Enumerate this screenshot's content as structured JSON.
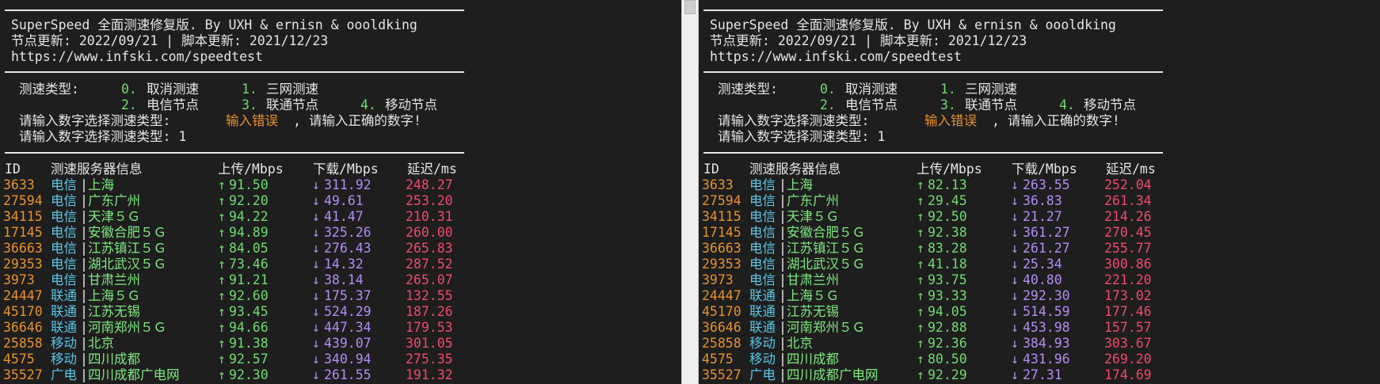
{
  "header": {
    "title": "SuperSpeed 全面测速修复版. By UXH & ernisn & oooldking",
    "update": "节点更新: 2022/09/21 | 脚本更新: 2021/12/23",
    "url": "https://www.infski.com/speedtest"
  },
  "menu": {
    "label": "测速类型:",
    "options": [
      {
        "num": "0.",
        "label": "取消测速"
      },
      {
        "num": "1.",
        "label": "三网测速"
      },
      {
        "num": "2.",
        "label": "电信节点"
      },
      {
        "num": "3.",
        "label": "联通节点"
      },
      {
        "num": "4.",
        "label": "移动节点"
      }
    ],
    "prompt1": "请输入数字选择测速类型:",
    "error": "输入错误",
    "error_suffix": ", 请输入正确的数字!",
    "prompt2": "请输入数字选择测速类型: 1"
  },
  "table": {
    "columns": [
      "ID",
      "测速服务器信息",
      "上传/Mbps",
      "下载/Mbps",
      "延迟/ms"
    ],
    "up_icon": "up-arrow-icon",
    "down_icon": "down-arrow-icon"
  },
  "left": {
    "rows": [
      {
        "id": "3633",
        "isp": "电信",
        "loc": "上海",
        "up": "91.50",
        "down": "311.92",
        "lat": "248.27"
      },
      {
        "id": "27594",
        "isp": "电信",
        "loc": "广东广州",
        "up": "92.20",
        "down": "49.61",
        "lat": "253.20"
      },
      {
        "id": "34115",
        "isp": "电信",
        "loc": "天津５Ｇ",
        "up": "94.22",
        "down": "41.47",
        "lat": "210.31"
      },
      {
        "id": "17145",
        "isp": "电信",
        "loc": "安徽合肥５Ｇ",
        "up": "94.89",
        "down": "325.26",
        "lat": "260.00"
      },
      {
        "id": "36663",
        "isp": "电信",
        "loc": "江苏镇江５Ｇ",
        "up": "84.05",
        "down": "276.43",
        "lat": "265.83"
      },
      {
        "id": "29353",
        "isp": "电信",
        "loc": "湖北武汉５Ｇ",
        "up": "73.46",
        "down": "14.32",
        "lat": "287.52"
      },
      {
        "id": "3973",
        "isp": "电信",
        "loc": "甘肃兰州",
        "up": "91.21",
        "down": "38.14",
        "lat": "265.07"
      },
      {
        "id": "24447",
        "isp": "联通",
        "loc": "上海５Ｇ",
        "up": "92.60",
        "down": "175.37",
        "lat": "132.55"
      },
      {
        "id": "45170",
        "isp": "联通",
        "loc": "江苏无锡",
        "up": "93.45",
        "down": "524.29",
        "lat": "187.26"
      },
      {
        "id": "36646",
        "isp": "联通",
        "loc": "河南郑州５Ｇ",
        "up": "94.66",
        "down": "447.34",
        "lat": "179.53"
      },
      {
        "id": "25858",
        "isp": "移动",
        "loc": "北京",
        "up": "91.38",
        "down": "439.07",
        "lat": "301.05"
      },
      {
        "id": "4575",
        "isp": "移动",
        "loc": "四川成都",
        "up": "92.57",
        "down": "340.94",
        "lat": "275.35"
      },
      {
        "id": "35527",
        "isp": "广电",
        "loc": "四川成都广电网",
        "up": "92.30",
        "down": "261.55",
        "lat": "191.32"
      }
    ]
  },
  "right": {
    "rows": [
      {
        "id": "3633",
        "isp": "电信",
        "loc": "上海",
        "up": "82.13",
        "down": "263.55",
        "lat": "252.04"
      },
      {
        "id": "27594",
        "isp": "电信",
        "loc": "广东广州",
        "up": "29.45",
        "down": "36.83",
        "lat": "261.34"
      },
      {
        "id": "34115",
        "isp": "电信",
        "loc": "天津５Ｇ",
        "up": "92.50",
        "down": "21.27",
        "lat": "214.26"
      },
      {
        "id": "17145",
        "isp": "电信",
        "loc": "安徽合肥５Ｇ",
        "up": "92.38",
        "down": "361.27",
        "lat": "270.45"
      },
      {
        "id": "36663",
        "isp": "电信",
        "loc": "江苏镇江５Ｇ",
        "up": "83.28",
        "down": "261.27",
        "lat": "255.77"
      },
      {
        "id": "29353",
        "isp": "电信",
        "loc": "湖北武汉５Ｇ",
        "up": "41.18",
        "down": "25.34",
        "lat": "300.86"
      },
      {
        "id": "3973",
        "isp": "电信",
        "loc": "甘肃兰州",
        "up": "93.75",
        "down": "40.80",
        "lat": "221.20"
      },
      {
        "id": "24447",
        "isp": "联通",
        "loc": "上海５Ｇ",
        "up": "93.33",
        "down": "292.30",
        "lat": "173.02"
      },
      {
        "id": "45170",
        "isp": "联通",
        "loc": "江苏无锡",
        "up": "94.05",
        "down": "514.59",
        "lat": "177.46"
      },
      {
        "id": "36646",
        "isp": "联通",
        "loc": "河南郑州５Ｇ",
        "up": "92.88",
        "down": "453.98",
        "lat": "157.57"
      },
      {
        "id": "25858",
        "isp": "移动",
        "loc": "北京",
        "up": "92.36",
        "down": "384.93",
        "lat": "303.67"
      },
      {
        "id": "4575",
        "isp": "移动",
        "loc": "四川成都",
        "up": "80.50",
        "down": "431.96",
        "lat": "269.20"
      },
      {
        "id": "35527",
        "isp": "广电",
        "loc": "四川成都广电网",
        "up": "92.29",
        "down": "27.31",
        "lat": "174.69"
      }
    ]
  },
  "colors": {
    "background": "#1e1e1e",
    "text": "#e6e6e6",
    "green": "#6fdc6f",
    "orange": "#e8922e",
    "cyan": "#5ac8e8",
    "purple": "#b58cf5",
    "red": "#f04a6a"
  }
}
